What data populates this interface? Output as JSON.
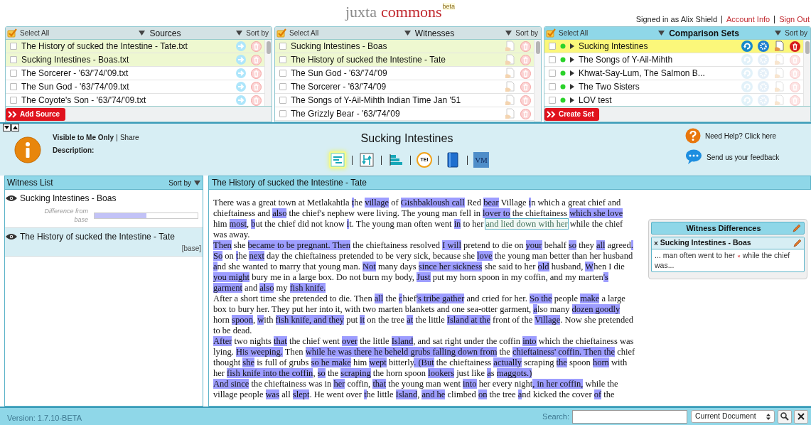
{
  "header": {
    "logo": "juxta",
    "logo_accent": "commons",
    "logo_badge": "beta",
    "signed_in": "Signed in as Alix Shield",
    "links": [
      "Account Info",
      "Sign Out"
    ]
  },
  "panels": [
    {
      "kind": "sources",
      "select_all": "Select All",
      "title": "Sources",
      "sort": "Sort by",
      "button": "Add Source",
      "items": [
        {
          "name": "The History of sucked the Intestine - Tate.txt",
          "checked": false,
          "selected": true
        },
        {
          "name": "Sucking Intestines - Boas.txt",
          "checked": false,
          "selected": true
        },
        {
          "name": "The Sorcerer - '63/'74/'09.txt",
          "checked": false,
          "selected": false
        },
        {
          "name": "The Sun God - '63/'74/'09.txt",
          "checked": false,
          "selected": false
        },
        {
          "name": "The Coyote's Son - '63/'74/'09.txt",
          "checked": false,
          "selected": false
        }
      ]
    },
    {
      "kind": "witnesses",
      "select_all": "Select All",
      "title": "Witnesses",
      "sort": "Sort by",
      "items": [
        {
          "name": "Sucking Intestines - Boas",
          "checked": false,
          "selected": true
        },
        {
          "name": "The History of sucked the Intestine - Tate",
          "checked": false,
          "selected": true
        },
        {
          "name": "The Sun God - '63/'74/'09",
          "checked": false,
          "selected": false
        },
        {
          "name": "The Sorcerer - '63/'74/'09",
          "checked": false,
          "selected": false
        },
        {
          "name": "The Songs of Y-Ail-Mihth Indian Time Jan '51",
          "checked": false,
          "selected": false
        },
        {
          "name": "The Grizzly Bear - '63/'74/'09",
          "checked": false,
          "selected": false
        }
      ]
    },
    {
      "kind": "sets",
      "select_all": "Select All",
      "title": "Comparison Sets",
      "sort": "Sort by",
      "button": "Create Set",
      "items": [
        {
          "name": "Sucking Intestines",
          "checked": false,
          "selected": true
        },
        {
          "name": "The Songs of Y-Ail-Mihth",
          "checked": false,
          "selected": false
        },
        {
          "name": "Khwat-Say-Lum, The Salmon B...",
          "checked": false,
          "selected": false
        },
        {
          "name": "The Two Sisters",
          "checked": false,
          "selected": false
        },
        {
          "name": "LOV test",
          "checked": false,
          "selected": false
        }
      ]
    }
  ],
  "info": {
    "visibility": "Visible to Me Only",
    "share": "Share",
    "description_label": "Description:",
    "title": "Sucking Intestines",
    "help": "Need Help? Click here",
    "feedback": "Send us your feedback",
    "views": [
      {
        "kind": "heatmap",
        "selected": true
      },
      {
        "kind": "side-by-side",
        "selected": false
      },
      {
        "kind": "histogram",
        "selected": false
      },
      {
        "kind": "tei",
        "label": "TEI",
        "selected": false
      },
      {
        "kind": "book",
        "selected": false
      },
      {
        "kind": "vm",
        "label": "VM",
        "selected": false
      }
    ]
  },
  "witness_list": {
    "title": "Witness List",
    "sort": "Sort by",
    "items": [
      {
        "name": "Sucking Intestines - Boas",
        "selected": false,
        "diff_label": "Difference from base",
        "level": 0.5
      },
      {
        "name": "The History of sucked the Intestine - Tate",
        "selected": true,
        "base_tag": "[base]"
      }
    ]
  },
  "document": {
    "title": "The History of sucked the Intestine - Tate",
    "paragraphs": [
      [
        {
          "text": "There was a great town at Metlakahtla ",
          "kind": "plain"
        },
        {
          "text": "t",
          "kind": "change"
        },
        {
          "text": "he ",
          "kind": "plain"
        },
        {
          "text": "village",
          "kind": "change"
        },
        {
          "text": " of ",
          "kind": "plain"
        },
        {
          "text": "Gishbakloush call",
          "kind": "change"
        },
        {
          "text": " Red ",
          "kind": "plain"
        },
        {
          "text": "bear",
          "kind": "change"
        },
        {
          "text": " Village ",
          "kind": "plain"
        },
        {
          "text": "i",
          "kind": "change"
        },
        {
          "text": "n which a great chief and chieftainess and ",
          "kind": "plain"
        },
        {
          "text": "also",
          "kind": "change"
        },
        {
          "text": " the chief's nephew were living. The young man fell in ",
          "kind": "plain"
        },
        {
          "text": "lover to",
          "kind": "change"
        },
        {
          "text": " the chieftainess ",
          "kind": "plain"
        },
        {
          "text": "which she love",
          "kind": "change"
        },
        {
          "text": " him ",
          "kind": "plain"
        },
        {
          "text": "most",
          "kind": "change"
        },
        {
          "text": ", ",
          "kind": "plain"
        },
        {
          "text": "b",
          "kind": "change"
        },
        {
          "text": "ut the chief did not know ",
          "kind": "plain"
        },
        {
          "text": "i",
          "kind": "change"
        },
        {
          "text": "t. The young man often went ",
          "kind": "plain"
        },
        {
          "text": "in",
          "kind": "change"
        },
        {
          "text": " to her ",
          "kind": "plain"
        },
        {
          "text": "and lied down with her",
          "kind": "focus"
        },
        {
          "text": " while the chief was away.",
          "kind": "plain"
        }
      ],
      [
        {
          "text": "Then",
          "kind": "change"
        },
        {
          "text": " she ",
          "kind": "plain"
        },
        {
          "text": "became to be pregnant. Then",
          "kind": "change"
        },
        {
          "text": " the chieftainess resolved ",
          "kind": "plain"
        },
        {
          "text": "I will",
          "kind": "change"
        },
        {
          "text": " pretend to die on ",
          "kind": "plain"
        },
        {
          "text": "your",
          "kind": "change"
        },
        {
          "text": " behalf ",
          "kind": "plain"
        },
        {
          "text": "so",
          "kind": "change"
        },
        {
          "text": " they ",
          "kind": "plain"
        },
        {
          "text": "all",
          "kind": "change"
        },
        {
          "text": " agreed",
          "kind": "plain"
        },
        {
          "text": ". ",
          "kind": "change"
        },
        {
          "text": "So",
          "kind": "change"
        },
        {
          "text": " on ",
          "kind": "plain"
        },
        {
          "text": "t",
          "kind": "change"
        },
        {
          "text": "he ",
          "kind": "plain"
        },
        {
          "text": "next",
          "kind": "change"
        },
        {
          "text": " day the chieftainess pretended to be very sick, because she ",
          "kind": "plain"
        },
        {
          "text": "love",
          "kind": "change"
        },
        {
          "text": " the young man better than her husband ",
          "kind": "plain"
        },
        {
          "text": "a",
          "kind": "change"
        },
        {
          "text": "nd she wanted to marry that young man. ",
          "kind": "plain"
        },
        {
          "text": "Not",
          "kind": "change"
        },
        {
          "text": " many days ",
          "kind": "plain"
        },
        {
          "text": "since her sickness",
          "kind": "change"
        },
        {
          "text": " she said to her ",
          "kind": "plain"
        },
        {
          "text": "old",
          "kind": "change"
        },
        {
          "text": " husband, ",
          "kind": "plain"
        },
        {
          "text": "W",
          "kind": "change"
        },
        {
          "text": "hen I die ",
          "kind": "plain"
        },
        {
          "text": "you might",
          "kind": "change"
        },
        {
          "text": " bury me in a large box. Do not burn my body, ",
          "kind": "plain"
        },
        {
          "text": "Just",
          "kind": "change"
        },
        {
          "text": " put my horn spoon in my coffin, and my marten",
          "kind": "plain"
        },
        {
          "text": "'s ",
          "kind": "change"
        },
        {
          "text": "garment",
          "kind": "change"
        },
        {
          "text": " and ",
          "kind": "plain"
        },
        {
          "text": "also",
          "kind": "change"
        },
        {
          "text": " my ",
          "kind": "plain"
        },
        {
          "text": "fish knife.",
          "kind": "change"
        }
      ],
      [
        {
          "text": "After a short time she pretended to die. Then ",
          "kind": "plain"
        },
        {
          "text": "all",
          "kind": "change"
        },
        {
          "text": " the ",
          "kind": "plain"
        },
        {
          "text": "c",
          "kind": "change"
        },
        {
          "text": "hief",
          "kind": "plain"
        },
        {
          "text": "'s tribe gather",
          "kind": "change"
        },
        {
          "text": " and cried for her. ",
          "kind": "plain"
        },
        {
          "text": "So the",
          "kind": "change"
        },
        {
          "text": " people ",
          "kind": "plain"
        },
        {
          "text": "make",
          "kind": "change"
        },
        {
          "text": " a large box to bury her. They put her into it, with two marten blankets and one sea-otter garment, ",
          "kind": "plain"
        },
        {
          "text": "a",
          "kind": "change"
        },
        {
          "text": "lso many ",
          "kind": "plain"
        },
        {
          "text": "dozen goodly",
          "kind": "change"
        },
        {
          "text": " horn ",
          "kind": "plain"
        },
        {
          "text": "spoon",
          "kind": "change"
        },
        {
          "text": ", ",
          "kind": "plain"
        },
        {
          "text": "w",
          "kind": "change"
        },
        {
          "text": "ith ",
          "kind": "plain"
        },
        {
          "text": "fish knife, and they",
          "kind": "change"
        },
        {
          "text": " put ",
          "kind": "plain"
        },
        {
          "text": "it",
          "kind": "change"
        },
        {
          "text": " on the tree ",
          "kind": "plain"
        },
        {
          "text": "at",
          "kind": "change"
        },
        {
          "text": " the little ",
          "kind": "plain"
        },
        {
          "text": "Island at the",
          "kind": "change"
        },
        {
          "text": " front of the ",
          "kind": "plain"
        },
        {
          "text": "Village",
          "kind": "change"
        },
        {
          "text": ". Now she pretended to be dead.",
          "kind": "plain"
        }
      ],
      [
        {
          "text": "After",
          "kind": "change"
        },
        {
          "text": " two nights ",
          "kind": "plain"
        },
        {
          "text": "that",
          "kind": "change"
        },
        {
          "text": " the chief went ",
          "kind": "plain"
        },
        {
          "text": "over",
          "kind": "change"
        },
        {
          "text": " the little ",
          "kind": "plain"
        },
        {
          "text": "Island",
          "kind": "change"
        },
        {
          "text": ", and sat right under the coffin ",
          "kind": "plain"
        },
        {
          "text": "into",
          "kind": "change"
        },
        {
          "text": " which the chieftainess was lying. ",
          "kind": "plain"
        },
        {
          "text": "His weeping.",
          "kind": "change"
        },
        {
          "text": " Then ",
          "kind": "plain"
        },
        {
          "text": "while he was there he beheld grubs falling down from",
          "kind": "change"
        },
        {
          "text": " the ",
          "kind": "plain"
        },
        {
          "text": "chieftainess' coffin. Then the",
          "kind": "change"
        },
        {
          "text": " chief thought ",
          "kind": "plain"
        },
        {
          "text": "she",
          "kind": "change"
        },
        {
          "text": " is full of grubs ",
          "kind": "plain"
        },
        {
          "text": "so he make",
          "kind": "change"
        },
        {
          "text": " him ",
          "kind": "plain"
        },
        {
          "text": "wept",
          "kind": "change"
        },
        {
          "text": " bitterly",
          "kind": "plain"
        },
        {
          "text": ". (But",
          "kind": "change"
        },
        {
          "text": " the chieftainess ",
          "kind": "plain"
        },
        {
          "text": "actually",
          "kind": "change"
        },
        {
          "text": " scraping ",
          "kind": "plain"
        },
        {
          "text": "the",
          "kind": "change"
        },
        {
          "text": " spoon ",
          "kind": "plain"
        },
        {
          "text": "horn",
          "kind": "change"
        },
        {
          "text": " with her ",
          "kind": "plain"
        },
        {
          "text": "fish knife into the coffin",
          "kind": "change"
        },
        {
          "text": ", ",
          "kind": "plain"
        },
        {
          "text": "so",
          "kind": "change"
        },
        {
          "text": " the ",
          "kind": "plain"
        },
        {
          "text": "scraping",
          "kind": "change"
        },
        {
          "text": " the horn spoon ",
          "kind": "plain"
        },
        {
          "text": "lookers",
          "kind": "change"
        },
        {
          "text": " just like ",
          "kind": "plain"
        },
        {
          "text": "a",
          "kind": "change"
        },
        {
          "text": "s ",
          "kind": "plain"
        },
        {
          "text": "maggots.)",
          "kind": "change"
        }
      ],
      [
        {
          "text": "And since",
          "kind": "change"
        },
        {
          "text": " the chieftainess was in ",
          "kind": "plain"
        },
        {
          "text": "her",
          "kind": "change"
        },
        {
          "text": " coffin, ",
          "kind": "plain"
        },
        {
          "text": "that",
          "kind": "change"
        },
        {
          "text": " the young man went ",
          "kind": "plain"
        },
        {
          "text": "into",
          "kind": "change"
        },
        {
          "text": " her every night",
          "kind": "plain"
        },
        {
          "text": ", in her coffin,",
          "kind": "change"
        },
        {
          "text": " while the village people ",
          "kind": "plain"
        },
        {
          "text": "was",
          "kind": "change"
        },
        {
          "text": " all ",
          "kind": "plain"
        },
        {
          "text": "slept",
          "kind": "change"
        },
        {
          "text": ". He went over ",
          "kind": "plain"
        },
        {
          "text": "t",
          "kind": "change"
        },
        {
          "text": "he little ",
          "kind": "plain"
        },
        {
          "text": "Island",
          "kind": "change"
        },
        {
          "text": ", ",
          "kind": "plain"
        },
        {
          "text": "and he",
          "kind": "change"
        },
        {
          "text": " climbed ",
          "kind": "plain"
        },
        {
          "text": "on",
          "kind": "change"
        },
        {
          "text": " the tree ",
          "kind": "plain"
        },
        {
          "text": "a",
          "kind": "change"
        },
        {
          "text": "nd kicked the cover ",
          "kind": "plain"
        },
        {
          "text": "of",
          "kind": "change"
        },
        {
          "text": " the",
          "kind": "plain"
        }
      ]
    ],
    "differences": {
      "title": "Witness Differences",
      "items": [
        {
          "marker": "×",
          "name": "Sucking Intestines - Boas",
          "before": "... man often went to her",
          "gap": "×",
          "after": "while the chief was..."
        }
      ]
    }
  },
  "status_bar": {
    "version": "Version: 1.7.10-BETA",
    "search_label": "Search:",
    "scope": "Current Document"
  }
}
